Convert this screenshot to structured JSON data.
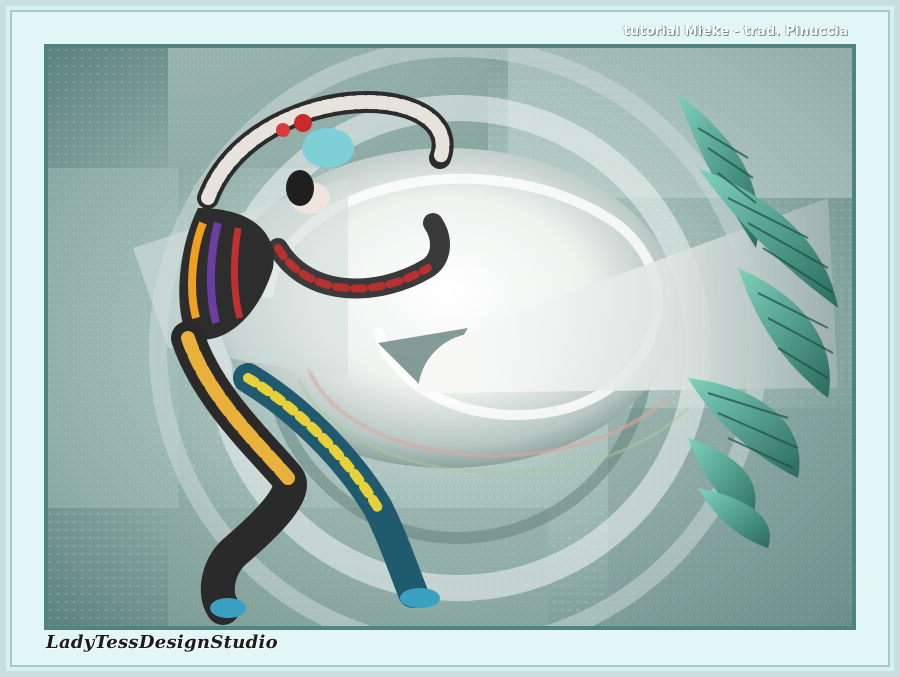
{
  "credit_text": "tutorial Mieke - trad. Pinuccia",
  "signature_text": "LadyTessDesignStudio",
  "colors": {
    "frame_light": "#d6f1f1",
    "frame_border": "#4f8480",
    "teal": "#4fa896",
    "teal_dark": "#2b6a5e",
    "swirl_white": "#f4f6f4",
    "background_gray": "#8aa8a4"
  }
}
